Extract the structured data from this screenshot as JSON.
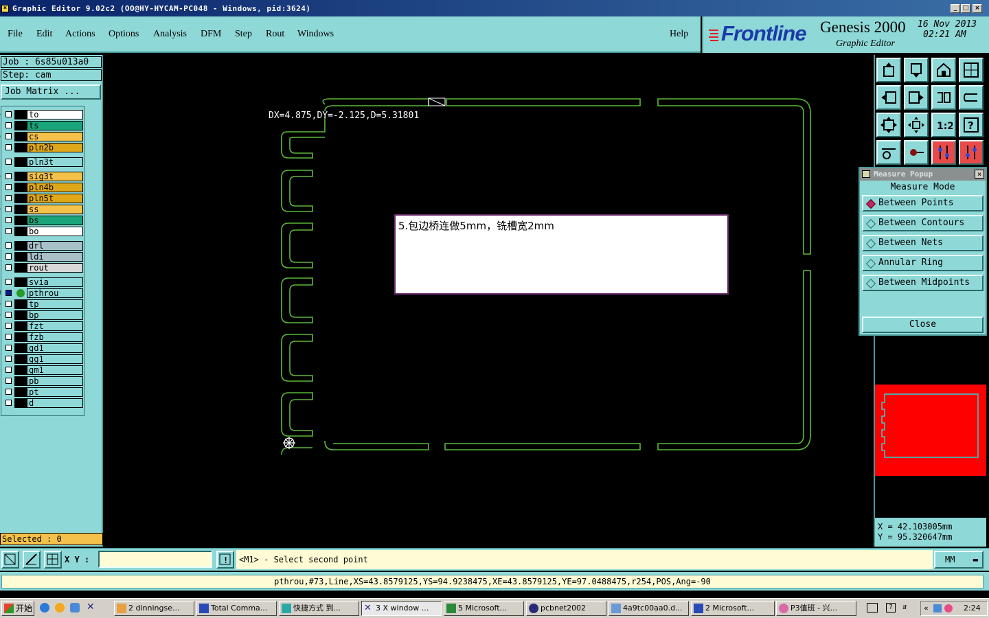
{
  "window": {
    "title": "Graphic Editor 9.02c2 (OO@HY-HYCAM-PC048 - Windows, pid:3624)"
  },
  "menu": {
    "items": [
      "File",
      "Edit",
      "Actions",
      "Options",
      "Analysis",
      "DFM",
      "Step",
      "Rout",
      "Windows"
    ],
    "help": "Help"
  },
  "brand": {
    "logo": "Frontline",
    "product": "Genesis 2000",
    "subtitle": "Graphic Editor",
    "date": "16 Nov 2013",
    "time": "02:21 AM"
  },
  "job": {
    "job_label": "Job : 6s85u013a0",
    "step_label": "Step: cam",
    "job_matrix_button": "Job Matrix ..."
  },
  "layers": [
    {
      "name": "to",
      "color": "#ffffff",
      "mark": "✎"
    },
    {
      "name": "ts",
      "color": "#1aa67a",
      "mark": ""
    },
    {
      "name": "cs",
      "color": "#f4c24a",
      "mark": "✎"
    },
    {
      "name": "pln2b",
      "color": "#e0a818",
      "mark": ""
    },
    {
      "name": "pln3t",
      "color": "#8fd8d8",
      "mark": ""
    },
    {
      "name": "sig3t",
      "color": "#f4c24a",
      "mark": "✎"
    },
    {
      "name": "pln4b",
      "color": "#e0a818",
      "mark": ""
    },
    {
      "name": "pln5t",
      "color": "#e0a818",
      "mark": ""
    },
    {
      "name": "ss",
      "color": "#f4c24a",
      "mark": "✎"
    },
    {
      "name": "bs",
      "color": "#1aa67a",
      "mark": ""
    },
    {
      "name": "bo",
      "color": "#ffffff",
      "mark": ""
    },
    {
      "name": "drl",
      "color": "#a8c0c8",
      "mark": ""
    },
    {
      "name": "ldi",
      "color": "#a8c0c8",
      "mark": ""
    },
    {
      "name": "rout",
      "color": "#d8d8d8",
      "mark": ""
    },
    {
      "name": "svia",
      "color": "#8fd8d8",
      "mark": ""
    },
    {
      "name": "pthrou",
      "color": "#8fd8d8",
      "mark": "▣"
    },
    {
      "name": "tp",
      "color": "#8fd8d8",
      "mark": "✎"
    },
    {
      "name": "bp",
      "color": "#8fd8d8",
      "mark": "✎"
    },
    {
      "name": "fzt",
      "color": "#8fd8d8",
      "mark": ""
    },
    {
      "name": "fzb",
      "color": "#8fd8d8",
      "mark": ""
    },
    {
      "name": "gd1",
      "color": "#8fd8d8",
      "mark": ""
    },
    {
      "name": "gg1",
      "color": "#8fd8d8",
      "mark": ""
    },
    {
      "name": "gm1",
      "color": "#8fd8d8",
      "mark": ""
    },
    {
      "name": "pb",
      "color": "#8fd8d8",
      "mark": ""
    },
    {
      "name": "pt",
      "color": "#8fd8d8",
      "mark": ""
    },
    {
      "name": "d",
      "color": "#8fd8d8",
      "mark": ""
    }
  ],
  "selected": "Selected : 0",
  "canvas": {
    "measure_label": "DX=4.875,DY=-2.125,D=5.31801",
    "note": "5.包边桥连做5mm，铣槽宽2mm",
    "outline_color": "#5cb83a"
  },
  "measure_popup": {
    "title": "Measure Popup",
    "heading": "Measure Mode",
    "options": [
      "Between Points",
      "Between Contours",
      "Between Nets",
      "Annular Ring",
      "Between Midpoints"
    ],
    "selected_option": "Between Points",
    "close": "Close"
  },
  "coords": {
    "x": "X  =  42.103005mm",
    "y": "Y  =  95.320647mm"
  },
  "bottom": {
    "xy_label": "X Y :",
    "xy_value": "",
    "prompt": "<M1> - Select second point",
    "units": "MM"
  },
  "status": "pthrou,#73,Line,XS=43.8579125,YS=94.9238475,XE=43.8579125,YE=97.0488475,r254,POS,Ang=-90",
  "taskbar": {
    "start": "开始",
    "buttons": [
      "2 dinningse...",
      "Total Comma...",
      "快捷方式 到...",
      "3 X window ...",
      "5 Microsoft...",
      "pcbnet2002",
      "4a9tc00aa0.d...",
      "2 Microsoft...",
      "P3值班 - 兴..."
    ],
    "active": "3 X window ...",
    "clock": "2:24"
  }
}
